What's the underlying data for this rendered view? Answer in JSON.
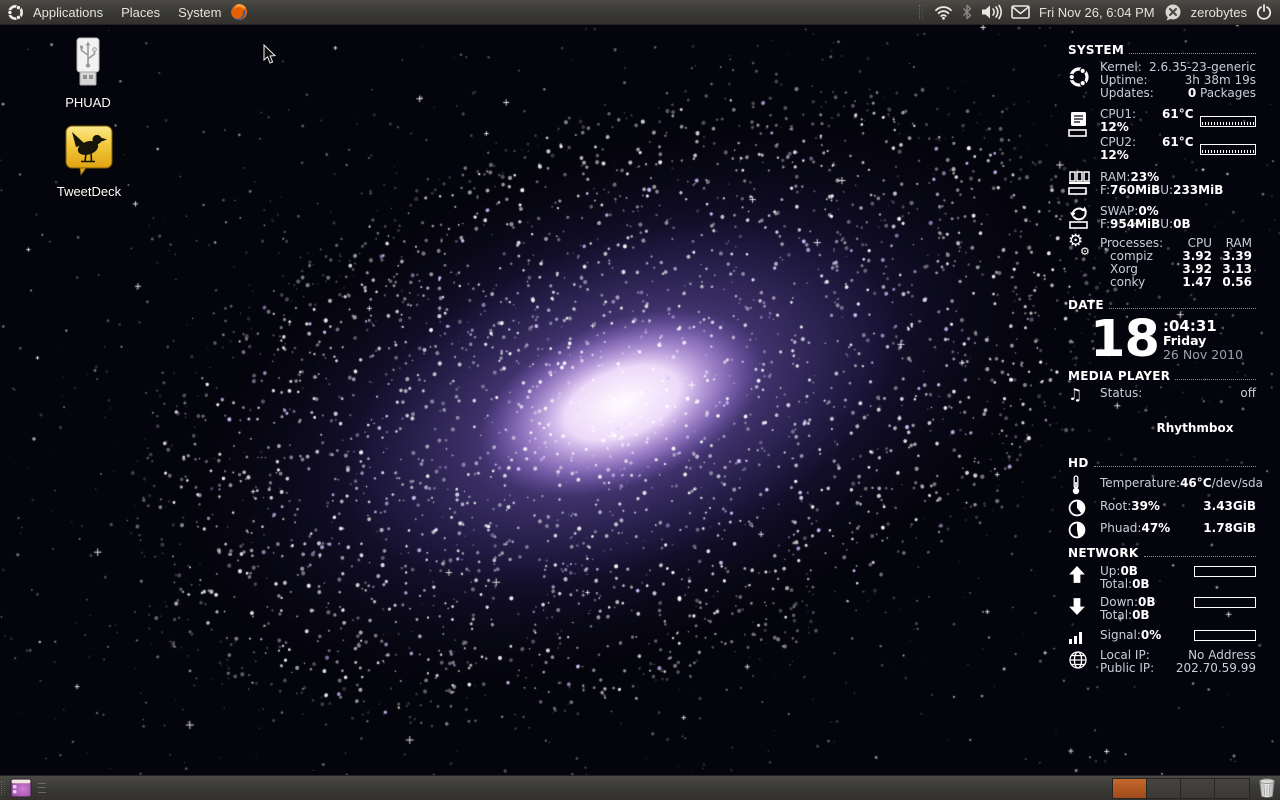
{
  "top_panel": {
    "menus": {
      "applications": "Applications",
      "places": "Places",
      "system": "System"
    },
    "clock": "Fri Nov 26, 6:04 PM",
    "username": "zerobytes"
  },
  "desktop": {
    "icons": [
      {
        "label": "PHUAD"
      },
      {
        "label": "TweetDeck"
      }
    ]
  },
  "conky": {
    "system": {
      "header": "SYSTEM",
      "kernel_label": "Kernel:",
      "kernel": "2.6.35-23-generic",
      "uptime_label": "Uptime:",
      "uptime": "3h 38m 19s",
      "updates_label": "Updates:",
      "updates_count": "0",
      "updates_suffix": " Packages",
      "cpu1_label": "CPU1: ",
      "cpu1_pct": "12%",
      "cpu1_temp": "61°C",
      "cpu2_label": "CPU2: ",
      "cpu2_pct": "12%",
      "cpu2_temp": "61°C",
      "ram_label": "RAM: ",
      "ram_pct": "23%",
      "ram_f_label": "F: ",
      "ram_free": "760MiB",
      "ram_u_label": " U: ",
      "ram_used": "233MiB",
      "swap_label": "SWAP: ",
      "swap_pct": "0%",
      "swap_f_label": "F: ",
      "swap_free": "954MiB",
      "swap_u_label": " U: ",
      "swap_used": "0B",
      "processes_label": "Processes:",
      "col_cpu": "CPU",
      "col_ram": "RAM",
      "processes": [
        {
          "name": "compiz",
          "cpu": "3.92",
          "ram": "3.39"
        },
        {
          "name": "Xorg",
          "cpu": "3.92",
          "ram": "3.13"
        },
        {
          "name": "conky",
          "cpu": "1.47",
          "ram": "0.56"
        }
      ]
    },
    "date": {
      "header": "DATE",
      "day": "18",
      "time": ":04:31",
      "weekday": "Friday",
      "full_date": "26 Nov 2010"
    },
    "media": {
      "header": "MEDIA PLAYER",
      "status_label": "Status:",
      "status_value": "off",
      "player": "Rhythmbox"
    },
    "hd": {
      "header": "HD",
      "rows": [
        {
          "label": "Temperature: ",
          "value": "46°C",
          "right": "/dev/sda"
        },
        {
          "label": "Root: ",
          "value": "39%",
          "right": "3.43GiB"
        },
        {
          "label": "Phuad: ",
          "value": "47%",
          "right": "1.78GiB"
        }
      ]
    },
    "network": {
      "header": "NETWORK",
      "up_label": "Up: ",
      "up_value": "0B",
      "up_total_label": "Total: ",
      "up_total": "0B",
      "down_label": "Down: ",
      "down_value": "0B",
      "down_total_label": "Total: ",
      "down_total": "0B",
      "signal_label": "Signal: ",
      "signal_value": "0%",
      "local_label": "Local IP:",
      "local_value": "No Address",
      "public_label": "Public IP:",
      "public_value": "202.70.59.99"
    }
  },
  "bottom_panel": {
    "workspaces": {
      "count": 4,
      "active": 0
    }
  },
  "icons": {
    "music_note": "♫",
    "gear": "⚙"
  },
  "colors": {
    "panel_bg": "#3b3a36",
    "workspace_active": "#b85a20",
    "galaxy_glow": "#8a66d2",
    "conky_text": "#c9ced8",
    "value_white": "#ffffff"
  }
}
